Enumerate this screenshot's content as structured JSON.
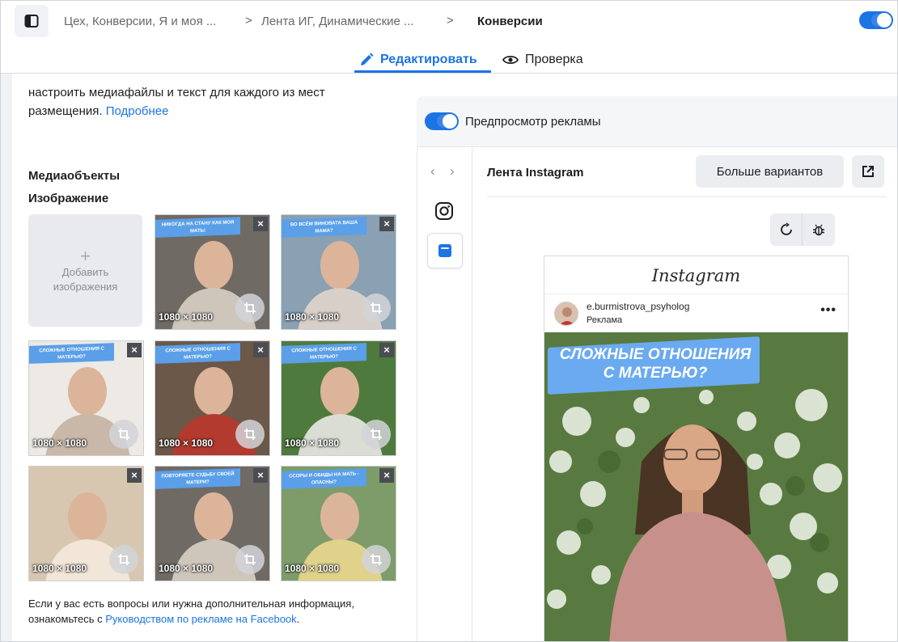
{
  "topbar": {
    "crumb1": "Цех, Конверсии, Я и моя ...",
    "crumb2": "Лента ИГ, Динамические ...",
    "separator": ">",
    "current": "Конверсии"
  },
  "tabs": {
    "edit": "Редактировать",
    "review": "Проверка"
  },
  "left": {
    "intro_text": "настроить медиафайлы и текст для каждого из мест размещения.",
    "intro_link": "Подробнее",
    "media_title": "Медиаобъекты",
    "image_title": "Изображение",
    "add_image_plus": "+",
    "add_image_label": "Добавить изображения",
    "thumbnails": [
      {
        "banner": "НИКОГДА НА СТАНУ КАК МОЯ МАТЬ!",
        "size": "1080 × 1080"
      },
      {
        "banner": "ВО ВСЁМ ВИНОВАТА ВАША МАМА?",
        "size": "1080 × 1080"
      },
      {
        "banner": "СЛОЖНЫЕ ОТНОШЕНИЯ С МАТЕРЬЮ?",
        "size": "1080 × 1080"
      },
      {
        "banner": "СЛОЖНЫЕ ОТНОШЕНИЯ С МАТЕРЬЮ?",
        "size": "1080 × 1080"
      },
      {
        "banner": "СЛОЖНЫЕ ОТНОШЕНИЯ С МАТЕРЬЮ?",
        "size": "1080 × 1080"
      },
      {
        "banner": "",
        "size": "1080 × 1080"
      },
      {
        "banner": "ПОВТОРЯЕТЕ СУДЬБУ СВОЕЙ МАТЕРИ?",
        "size": "1080 × 1080"
      },
      {
        "banner": "ССОРЫ И ОБИДЫ НА МАТЬ - ОПАСНЫ?",
        "size": "1080 × 1080"
      }
    ],
    "help_text": "Если у вас есть вопросы или нужна дополнительная информация, ознакомьтесь с",
    "help_link": "Руководством по рекламе на Facebook",
    "help_end": "."
  },
  "right": {
    "preview_label": "Предпросмотр рекламы",
    "placement_name": "Лента Instagram",
    "more_variants": "Больше вариантов",
    "nav_prev": "‹",
    "nav_next": "›"
  },
  "instagram": {
    "logo": "Instagram",
    "username": "e.burmistrova_psyholog",
    "sponsored": "Реклама",
    "more": "•••",
    "banner_line1": "СЛОЖНЫЕ ОТНОШЕНИЯ",
    "banner_line2": "С МАТЕРЬЮ?"
  },
  "colors": {
    "accent": "#1b74e4",
    "banner": "#6aaaf0",
    "panel_bg": "#f5f6f7"
  }
}
